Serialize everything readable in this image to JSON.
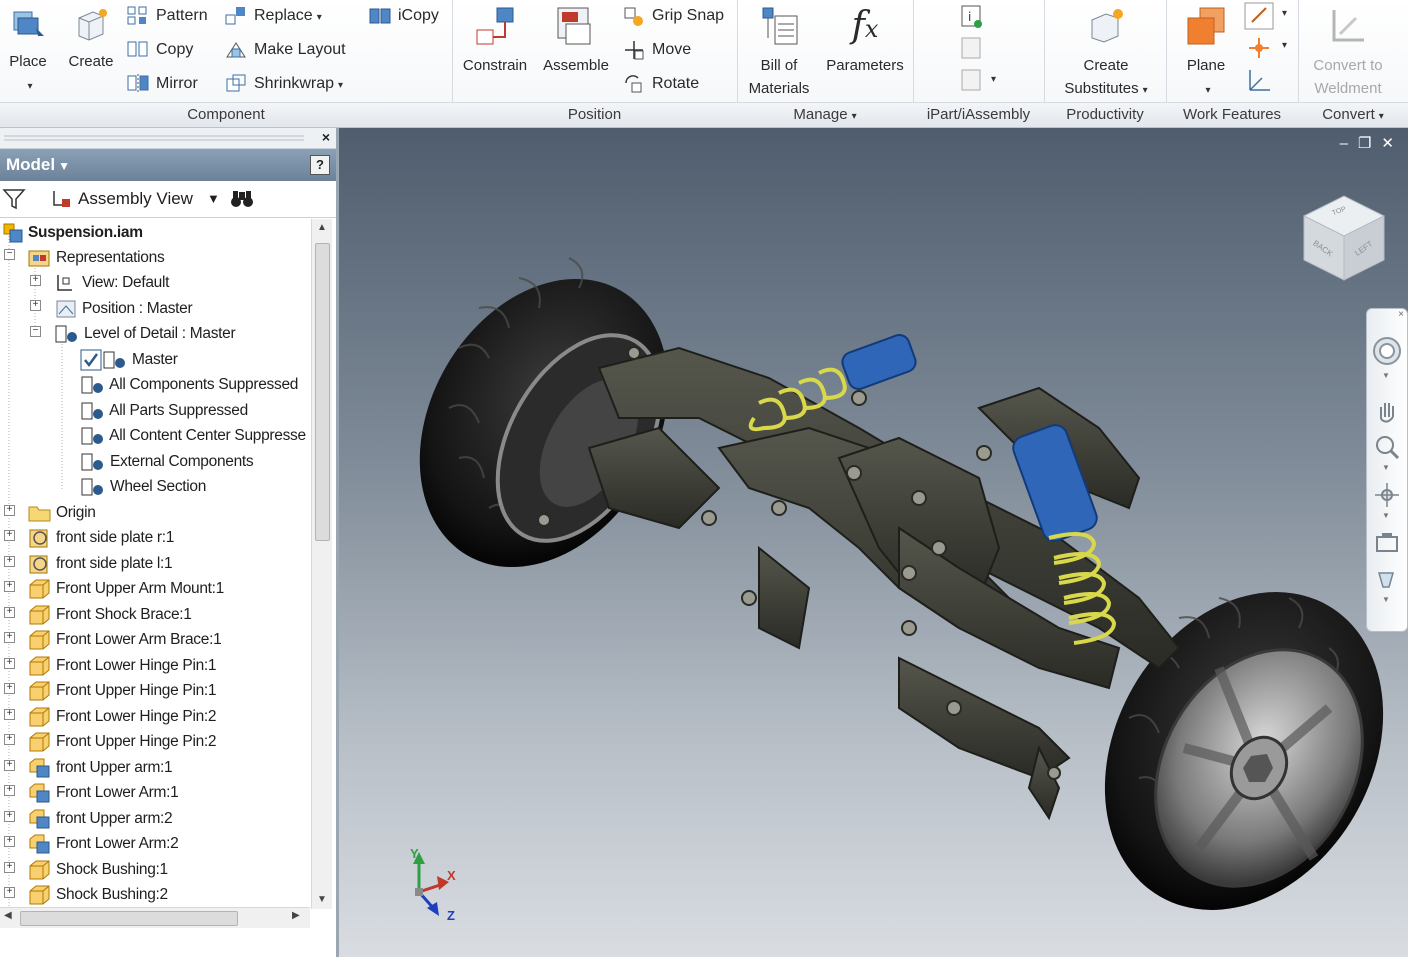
{
  "ribbon": {
    "component": {
      "label": "Component",
      "place": "Place",
      "create": "Create",
      "pattern": "Pattern",
      "copy": "Copy",
      "mirror": "Mirror",
      "replace": "Replace",
      "make_layout": "Make Layout",
      "shrinkwrap": "Shrinkwrap",
      "icopy": "iCopy"
    },
    "position": {
      "label": "Position",
      "constrain": "Constrain",
      "assemble": "Assemble",
      "grip_snap": "Grip Snap",
      "move": "Move",
      "rotate": "Rotate"
    },
    "manage": {
      "label": "Manage",
      "bom_line1": "Bill of",
      "bom_line2": "Materials",
      "parameters": "Parameters"
    },
    "ipart": {
      "label": "iPart/iAssembly"
    },
    "productivity": {
      "label": "Productivity",
      "line1": "Create",
      "line2": "Substitutes"
    },
    "work_features": {
      "label": "Work Features",
      "plane": "Plane"
    },
    "convert": {
      "label": "Convert",
      "line1": "Convert to",
      "line2": "Weldment"
    }
  },
  "browser": {
    "title": "Model",
    "view_mode": "Assembly View",
    "tree": [
      {
        "label": "Suspension.iam",
        "icon": "assembly-file-icon",
        "bold": true
      },
      {
        "label": "Representations",
        "icon": "representations-icon"
      },
      {
        "label": "View: Default",
        "icon": "view-rep-icon"
      },
      {
        "label": "Position : Master",
        "icon": "position-rep-icon"
      },
      {
        "label": "Level of Detail : Master",
        "icon": "lod-icon"
      },
      {
        "label": "Master",
        "icon": "lod-icon",
        "checked": true
      },
      {
        "label": "All Components Suppressed",
        "icon": "lod-icon"
      },
      {
        "label": "All Parts Suppressed",
        "icon": "lod-icon"
      },
      {
        "label": "All Content Center Suppresse",
        "icon": "lod-icon"
      },
      {
        "label": "External Components",
        "icon": "lod-icon"
      },
      {
        "label": "Wheel Section",
        "icon": "lod-icon"
      },
      {
        "label": "Origin",
        "icon": "folder-icon"
      },
      {
        "label": "front side plate r:1",
        "icon": "flexible-part-icon"
      },
      {
        "label": "front side plate l:1",
        "icon": "flexible-part-icon"
      },
      {
        "label": "Front Upper Arm Mount:1",
        "icon": "part-icon"
      },
      {
        "label": "Front Shock Brace:1",
        "icon": "part-icon"
      },
      {
        "label": "Front Lower Arm Brace:1",
        "icon": "part-icon"
      },
      {
        "label": "Front Lower Hinge Pin:1",
        "icon": "part-icon"
      },
      {
        "label": "Front Upper Hinge Pin:1",
        "icon": "part-icon"
      },
      {
        "label": "Front Lower Hinge Pin:2",
        "icon": "part-icon"
      },
      {
        "label": "Front Upper Hinge Pin:2",
        "icon": "part-icon"
      },
      {
        "label": "front Upper arm:1",
        "icon": "subassembly-icon"
      },
      {
        "label": "Front Lower Arm:1",
        "icon": "subassembly-icon"
      },
      {
        "label": "front Upper arm:2",
        "icon": "subassembly-icon"
      },
      {
        "label": "Front Lower Arm:2",
        "icon": "subassembly-icon"
      },
      {
        "label": "Shock Bushing:1",
        "icon": "part-icon"
      },
      {
        "label": "Shock Bushing:2",
        "icon": "part-icon"
      }
    ]
  },
  "viewcube": {
    "faces": [
      "BACK",
      "LEFT",
      "TOP"
    ]
  },
  "triad": {
    "x": "X",
    "y": "Y",
    "z": "Z"
  }
}
